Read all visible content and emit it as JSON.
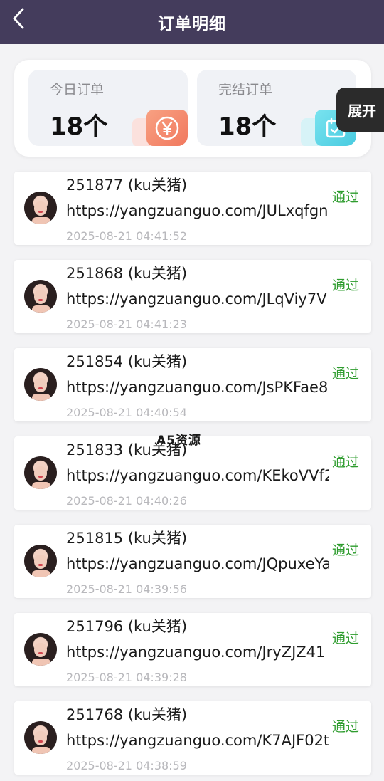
{
  "header": {
    "title": "订单明细"
  },
  "summary": {
    "today": {
      "label": "今日订单",
      "value": "18个"
    },
    "done": {
      "label": "完结订单",
      "value": "18个"
    }
  },
  "expand_label": "展开",
  "watermark": "A5资源",
  "orders": [
    {
      "id": "251877 (ku关猪)",
      "url": "https://yangzuanguo.com/JULxqfgn",
      "time": "2025-08-21 04:41:52",
      "status": "通过"
    },
    {
      "id": "251868 (ku关猪)",
      "url": "https://yangzuanguo.com/JLqViy7V",
      "time": "2025-08-21 04:41:23",
      "status": "通过"
    },
    {
      "id": "251854 (ku关猪)",
      "url": "https://yangzuanguo.com/JsPKFae8",
      "time": "2025-08-21 04:40:54",
      "status": "通过"
    },
    {
      "id": "251833 (ku关猪)",
      "url": "https://yangzuanguo.com/KEkoVVf2",
      "time": "2025-08-21 04:40:26",
      "status": "通过"
    },
    {
      "id": "251815 (ku关猪)",
      "url": "https://yangzuanguo.com/JQpuxeYa",
      "time": "2025-08-21 04:39:56",
      "status": "通过"
    },
    {
      "id": "251796 (ku关猪)",
      "url": "https://yangzuanguo.com/JryZJZ41",
      "time": "2025-08-21 04:39:28",
      "status": "通过"
    },
    {
      "id": "251768 (ku关猪)",
      "url": "https://yangzuanguo.com/K7AJF02t",
      "time": "2025-08-21 04:38:59",
      "status": "通过"
    }
  ]
}
